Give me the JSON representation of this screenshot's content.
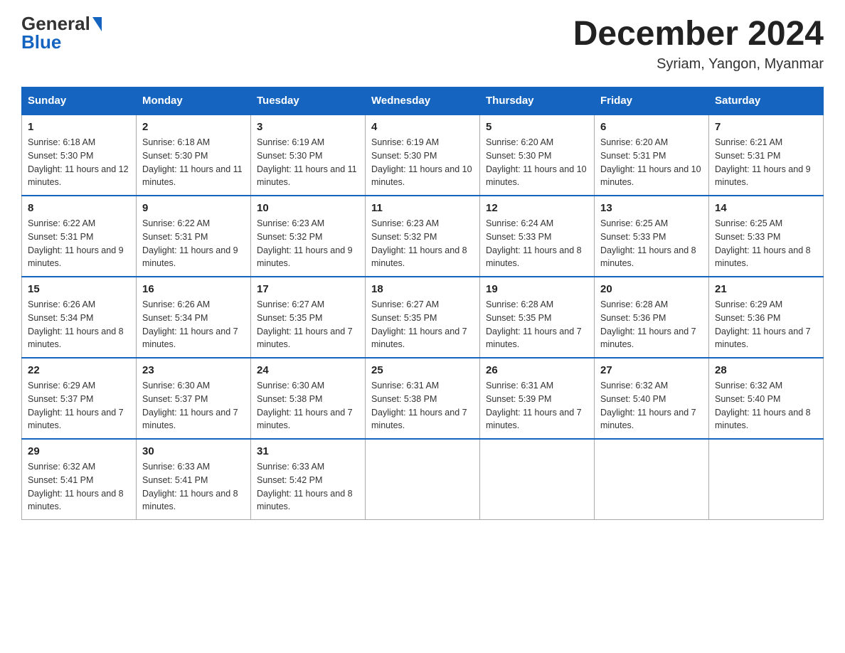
{
  "header": {
    "logo_general": "General",
    "logo_blue": "Blue",
    "month_title": "December 2024",
    "location": "Syriam, Yangon, Myanmar"
  },
  "columns": [
    "Sunday",
    "Monday",
    "Tuesday",
    "Wednesday",
    "Thursday",
    "Friday",
    "Saturday"
  ],
  "weeks": [
    [
      {
        "day": "1",
        "sunrise": "6:18 AM",
        "sunset": "5:30 PM",
        "daylight": "11 hours and 12 minutes."
      },
      {
        "day": "2",
        "sunrise": "6:18 AM",
        "sunset": "5:30 PM",
        "daylight": "11 hours and 11 minutes."
      },
      {
        "day": "3",
        "sunrise": "6:19 AM",
        "sunset": "5:30 PM",
        "daylight": "11 hours and 11 minutes."
      },
      {
        "day": "4",
        "sunrise": "6:19 AM",
        "sunset": "5:30 PM",
        "daylight": "11 hours and 10 minutes."
      },
      {
        "day": "5",
        "sunrise": "6:20 AM",
        "sunset": "5:30 PM",
        "daylight": "11 hours and 10 minutes."
      },
      {
        "day": "6",
        "sunrise": "6:20 AM",
        "sunset": "5:31 PM",
        "daylight": "11 hours and 10 minutes."
      },
      {
        "day": "7",
        "sunrise": "6:21 AM",
        "sunset": "5:31 PM",
        "daylight": "11 hours and 9 minutes."
      }
    ],
    [
      {
        "day": "8",
        "sunrise": "6:22 AM",
        "sunset": "5:31 PM",
        "daylight": "11 hours and 9 minutes."
      },
      {
        "day": "9",
        "sunrise": "6:22 AM",
        "sunset": "5:31 PM",
        "daylight": "11 hours and 9 minutes."
      },
      {
        "day": "10",
        "sunrise": "6:23 AM",
        "sunset": "5:32 PM",
        "daylight": "11 hours and 9 minutes."
      },
      {
        "day": "11",
        "sunrise": "6:23 AM",
        "sunset": "5:32 PM",
        "daylight": "11 hours and 8 minutes."
      },
      {
        "day": "12",
        "sunrise": "6:24 AM",
        "sunset": "5:33 PM",
        "daylight": "11 hours and 8 minutes."
      },
      {
        "day": "13",
        "sunrise": "6:25 AM",
        "sunset": "5:33 PM",
        "daylight": "11 hours and 8 minutes."
      },
      {
        "day": "14",
        "sunrise": "6:25 AM",
        "sunset": "5:33 PM",
        "daylight": "11 hours and 8 minutes."
      }
    ],
    [
      {
        "day": "15",
        "sunrise": "6:26 AM",
        "sunset": "5:34 PM",
        "daylight": "11 hours and 8 minutes."
      },
      {
        "day": "16",
        "sunrise": "6:26 AM",
        "sunset": "5:34 PM",
        "daylight": "11 hours and 7 minutes."
      },
      {
        "day": "17",
        "sunrise": "6:27 AM",
        "sunset": "5:35 PM",
        "daylight": "11 hours and 7 minutes."
      },
      {
        "day": "18",
        "sunrise": "6:27 AM",
        "sunset": "5:35 PM",
        "daylight": "11 hours and 7 minutes."
      },
      {
        "day": "19",
        "sunrise": "6:28 AM",
        "sunset": "5:35 PM",
        "daylight": "11 hours and 7 minutes."
      },
      {
        "day": "20",
        "sunrise": "6:28 AM",
        "sunset": "5:36 PM",
        "daylight": "11 hours and 7 minutes."
      },
      {
        "day": "21",
        "sunrise": "6:29 AM",
        "sunset": "5:36 PM",
        "daylight": "11 hours and 7 minutes."
      }
    ],
    [
      {
        "day": "22",
        "sunrise": "6:29 AM",
        "sunset": "5:37 PM",
        "daylight": "11 hours and 7 minutes."
      },
      {
        "day": "23",
        "sunrise": "6:30 AM",
        "sunset": "5:37 PM",
        "daylight": "11 hours and 7 minutes."
      },
      {
        "day": "24",
        "sunrise": "6:30 AM",
        "sunset": "5:38 PM",
        "daylight": "11 hours and 7 minutes."
      },
      {
        "day": "25",
        "sunrise": "6:31 AM",
        "sunset": "5:38 PM",
        "daylight": "11 hours and 7 minutes."
      },
      {
        "day": "26",
        "sunrise": "6:31 AM",
        "sunset": "5:39 PM",
        "daylight": "11 hours and 7 minutes."
      },
      {
        "day": "27",
        "sunrise": "6:32 AM",
        "sunset": "5:40 PM",
        "daylight": "11 hours and 7 minutes."
      },
      {
        "day": "28",
        "sunrise": "6:32 AM",
        "sunset": "5:40 PM",
        "daylight": "11 hours and 8 minutes."
      }
    ],
    [
      {
        "day": "29",
        "sunrise": "6:32 AM",
        "sunset": "5:41 PM",
        "daylight": "11 hours and 8 minutes."
      },
      {
        "day": "30",
        "sunrise": "6:33 AM",
        "sunset": "5:41 PM",
        "daylight": "11 hours and 8 minutes."
      },
      {
        "day": "31",
        "sunrise": "6:33 AM",
        "sunset": "5:42 PM",
        "daylight": "11 hours and 8 minutes."
      },
      null,
      null,
      null,
      null
    ]
  ]
}
